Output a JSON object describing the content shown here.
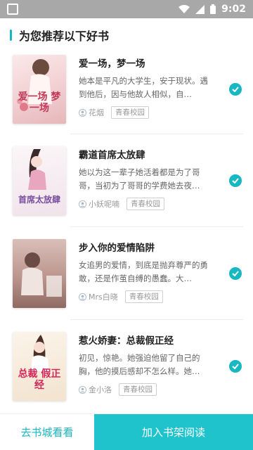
{
  "status_bar": {
    "time": "9:02"
  },
  "header": {
    "title": "为您推荐以下好书"
  },
  "books": [
    {
      "title": "爱一场，梦一场",
      "description": "她本是平凡的大学生，安于现状。遇到他后，因与他故人相似，自…",
      "author": "花烟",
      "tag": "青春校园",
      "cover_text": "爱一场 梦一场",
      "cover_color": "#f3d6d6",
      "cover_text_color": "#c23a5a",
      "selected": true
    },
    {
      "title": "霸道首席太放肆",
      "description": "她以为这一辈子她活着都是为了哥哥，当初为了哥哥的学费她去夜…",
      "author": "小妖呢喃",
      "tag": "青春校园",
      "cover_text": "首席太放肆",
      "cover_color": "#f5eef2",
      "cover_text_color": "#7a4ca0",
      "selected": true
    },
    {
      "title": "步入你的爱情陷阱",
      "description": "女追男的爱情，到底是抛弃尊严的勇敢，还是作茧自缚的愚蠢。大…",
      "author": "Mrs白晓",
      "tag": "青春校园",
      "cover_text": "",
      "cover_color": "#c9a8a2",
      "cover_text_color": "#6b3b3b",
      "selected": true
    },
    {
      "title": "惹火娇妻：总裁假正经",
      "description": "初见，惊艳。她强迫他留了自己的胸，他的摸后感却不怎么样。她…",
      "author": "金小洛",
      "tag": "青春校园",
      "cover_text": "总裁 假正经",
      "cover_color": "#f7f0e6",
      "cover_text_color": "#d0285a",
      "selected": true
    }
  ],
  "bottom": {
    "left_label": "去书城看看",
    "right_label": "加入书架阅读"
  },
  "colors": {
    "accent": "#17b8c2",
    "button_bg": "#1fc3cc"
  }
}
